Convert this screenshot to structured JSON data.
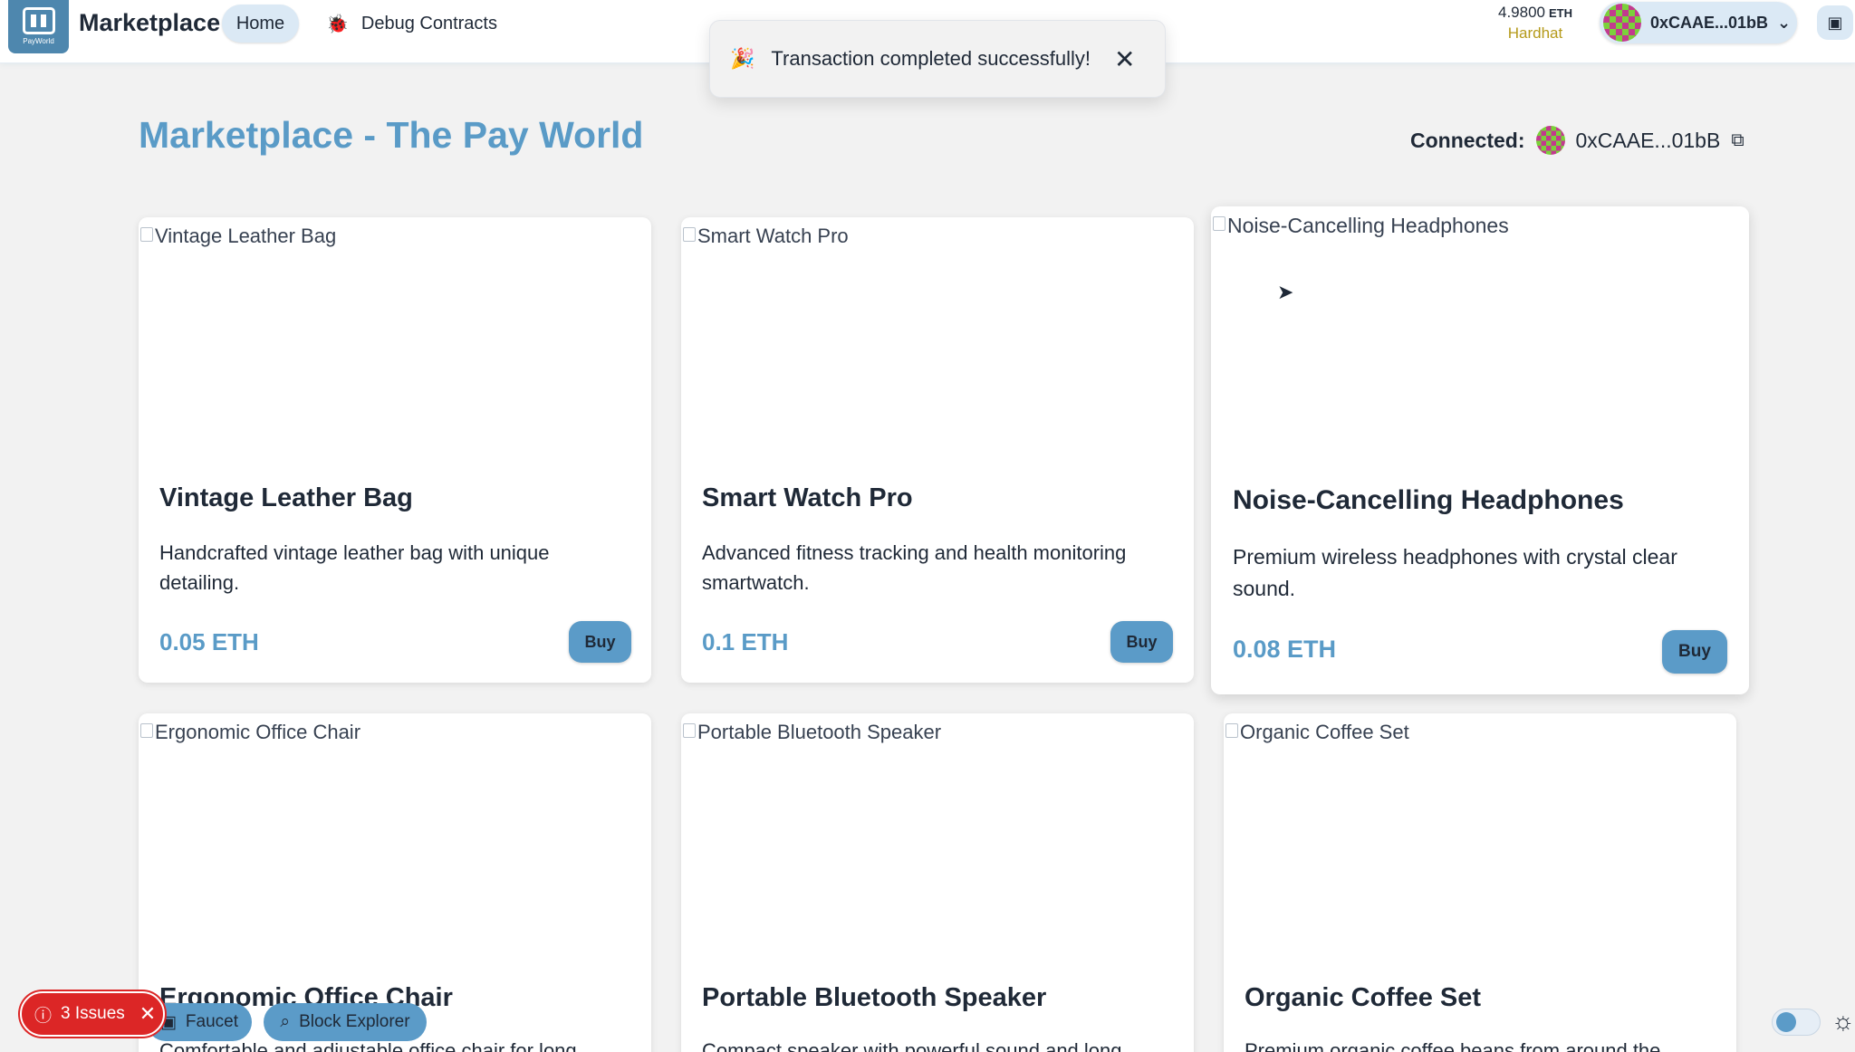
{
  "header": {
    "logo_text": "PayWorld",
    "brand": "Marketplace",
    "nav": {
      "home": "Home",
      "debug": "Debug Contracts"
    },
    "balance": {
      "value": "4.9800",
      "unit": "ETH"
    },
    "network": "Hardhat",
    "account": "0xCAAE...01bB"
  },
  "toast": {
    "message": "Transaction completed successfully!",
    "icon": "party-popper"
  },
  "page": {
    "title": "Marketplace - The Pay World",
    "connected_label": "Connected:",
    "connected_address": "0xCAAE...01bB"
  },
  "products": [
    {
      "image_alt": "Vintage Leather Bag",
      "title": "Vintage Leather Bag",
      "description": "Handcrafted vintage leather bag with unique detailing.",
      "price": "0.05 ETH",
      "buy": "Buy"
    },
    {
      "image_alt": "Smart Watch Pro",
      "title": "Smart Watch Pro",
      "description": "Advanced fitness tracking and health monitoring smartwatch.",
      "price": "0.1 ETH",
      "buy": "Buy"
    },
    {
      "image_alt": "Noise-Cancelling Headphones",
      "title": "Noise-Cancelling Headphones",
      "description": "Premium wireless headphones with crystal clear sound.",
      "price": "0.08 ETH",
      "buy": "Buy"
    },
    {
      "image_alt": "Ergonomic Office Chair",
      "title": "Ergonomic Office Chair",
      "description": "Comfortable and adjustable office chair for long",
      "price": "",
      "buy": ""
    },
    {
      "image_alt": "Portable Bluetooth Speaker",
      "title": "Portable Bluetooth Speaker",
      "description": "Compact speaker with powerful sound and long",
      "price": "",
      "buy": ""
    },
    {
      "image_alt": "Organic Coffee Set",
      "title": "Organic Coffee Set",
      "description": "Premium organic coffee beans from around the",
      "price": "",
      "buy": ""
    }
  ],
  "footer": {
    "issues": "3 Issues",
    "faucet": "Faucet",
    "block_explorer": "Block Explorer"
  },
  "colors": {
    "accent": "#5a9bc7",
    "button": "#5b9bc8",
    "network": "#b59a1a",
    "issues": "#dc2626"
  }
}
